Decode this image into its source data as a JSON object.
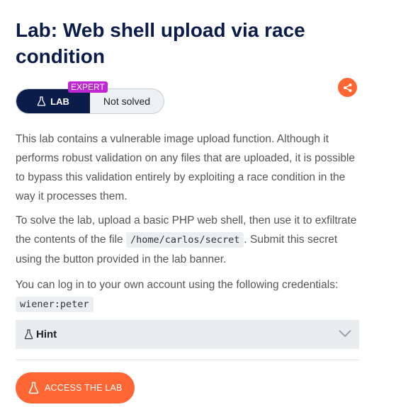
{
  "title": "Lab: Web shell upload via race condition",
  "badge": {
    "lab_label": "LAB",
    "status": "Not solved",
    "level": "EXPERT"
  },
  "icons": {
    "share": "share-icon",
    "flask": "flask-icon",
    "chevron": "chevron-down-icon"
  },
  "description": {
    "p1": "This lab contains a vulnerable image upload function. Although it performs robust validation on any files that are uploaded, it is possible to bypass this validation entirely by exploiting a race condition in the way it processes them.",
    "p2_before": "To solve the lab, upload a basic PHP web shell, then use it to exfiltrate the contents of the file ",
    "p2_code": "/home/carlos/secret",
    "p2_after": ". Submit this secret using the button provided in the lab banner.",
    "p3_text": "You can log in to your own account using the following credentials: ",
    "p3_code": "wiener:peter"
  },
  "hint": {
    "label": "Hint"
  },
  "access_button": {
    "label": "ACCESS THE LAB"
  },
  "colors": {
    "brand_navy": "#0a1d4a",
    "accent_orange": "#ff6633",
    "expert_magenta": "#c026d3"
  }
}
